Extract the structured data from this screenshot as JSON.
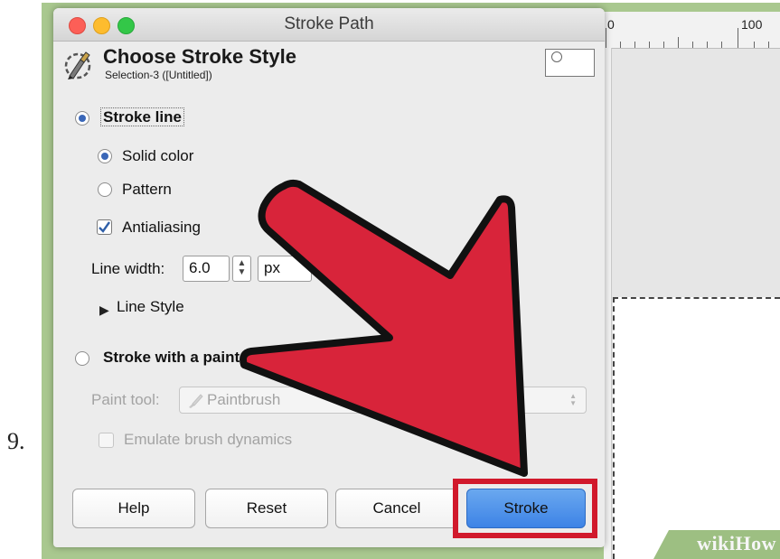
{
  "step_number": "9.",
  "window": {
    "title": "Stroke Path"
  },
  "header": {
    "title": "Choose Stroke Style",
    "subtitle": "Selection-3 ([Untitled])",
    "icon": "stroke-path-icon",
    "preview_icon": "preview-thumbnail-icon"
  },
  "options": {
    "stroke_line": "Stroke line",
    "solid_color": "Solid color",
    "pattern": "Pattern",
    "antialiasing": "Antialiasing",
    "line_width_label": "Line width:",
    "line_width_value": "6.0",
    "line_width_unit": "px",
    "line_style": "Line Style",
    "stroke_with_paint_tool": "Stroke with a paint",
    "paint_tool_label": "Paint tool:",
    "paint_tool_value": "Paintbrush",
    "emulate_brush_dynamics": "Emulate brush dynamics",
    "selected_mode": "stroke_line",
    "selected_fill": "solid_color",
    "antialiasing_checked": true,
    "emulate_checked": false
  },
  "buttons": {
    "help": "Help",
    "reset": "Reset",
    "cancel": "Cancel",
    "stroke": "Stroke"
  },
  "ruler": {
    "labels": [
      "0",
      "100"
    ]
  },
  "watermark": {
    "brand": "wikiHow"
  },
  "colors": {
    "accent_blue": "#3d83e6",
    "highlight_red": "#d1192c",
    "arrow_red": "#d8243a",
    "frame_green": "#a9c88f"
  }
}
